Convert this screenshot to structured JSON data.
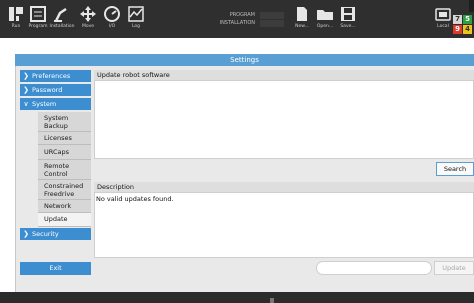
{
  "toolbar": {
    "run": "Run",
    "program": "Program",
    "installation": "Installation",
    "move": "Move",
    "io": "I/O",
    "log": "Log",
    "program_label": "PROGRAM",
    "installation_label": "INSTALLATION",
    "new": "New...",
    "open": "Open...",
    "save": "Save...",
    "local": "Local",
    "status_numbers": [
      "7",
      "5",
      "9",
      "4"
    ],
    "status_colors": [
      "#d6d6d6",
      "#2ea043",
      "#e23a2a",
      "#f0c419"
    ]
  },
  "settings_title": "Settings",
  "sidebar": {
    "preferences": "Preferences",
    "password": "Password",
    "system": "System",
    "system_items": [
      "System Backup",
      "Licenses",
      "URCaps",
      "Remote Control",
      "Constrained Freedrive",
      "Network",
      "Update"
    ],
    "security": "Security",
    "exit": "Exit"
  },
  "main": {
    "update_header": "Update robot software",
    "search_button": "Search",
    "description_header": "Description",
    "description_text": "No valid updates found.",
    "update_button": "Update"
  },
  "colors": {
    "accent": "#3d8dd1",
    "header_bar": "#5a9fd4",
    "toolbar_bg": "#2f2f2f"
  }
}
